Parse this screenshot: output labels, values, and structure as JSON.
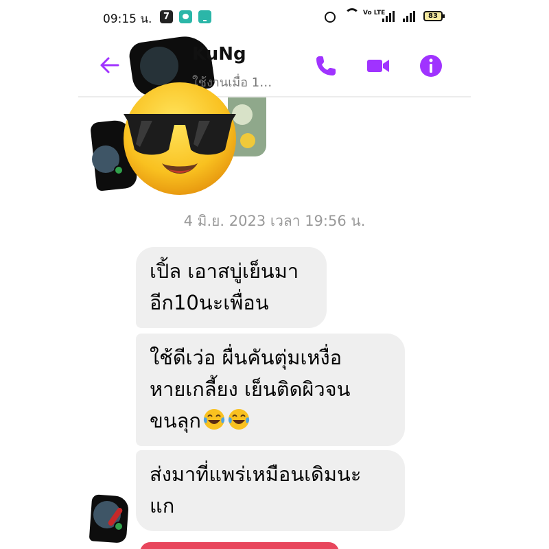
{
  "status_bar": {
    "time": "09:15 น.",
    "volte": "Vo LTE",
    "battery": "83"
  },
  "header": {
    "contact_name": "KuNg",
    "active_status": "ใช้งานเมื่อ 1…",
    "accent_color": "#a033ff",
    "icons": [
      "back-arrow-icon",
      "phone-icon",
      "video-camera-icon",
      "info-icon"
    ]
  },
  "conversation": {
    "date_separator": "4 มิ.ย. 2023 เวลา 19:56 น.",
    "messages": [
      {
        "lines": [
          "เปิ้ล เอาสบู่เย็นมา",
          "อีก10นะเพื่อน"
        ]
      },
      {
        "lines": [
          "ใช้ดีเว่อ ผื่นคันตุ่มเหงื่อ",
          "หายเกลี้ยง เย็นติดผิวจน",
          "ขนลุก"
        ],
        "trailing_emoji": "face-with-tears-of-joy"
      },
      {
        "lines": [
          "ส่งมาที่แพร่เหมือนเดิมนะ",
          "แก"
        ]
      }
    ],
    "bubble_color": "#efefef",
    "overlay_sticker": "smiling-face-with-sunglasses"
  }
}
